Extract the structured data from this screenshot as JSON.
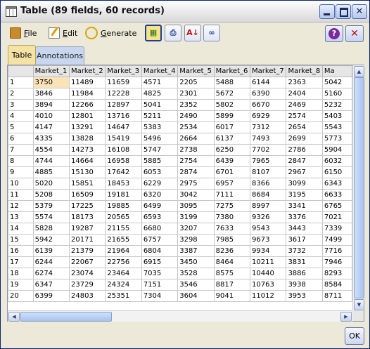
{
  "window": {
    "title": "Table (89 fields, 60 records)"
  },
  "toolbar": {
    "file_label": "File",
    "file_mnemonic": "F",
    "edit_label": "Edit",
    "edit_mnemonic": "E",
    "generate_label": "Generate",
    "generate_mnemonic": "G",
    "help_glyph": "?",
    "close_glyph": "✕"
  },
  "tabs": [
    {
      "label": "Table"
    },
    {
      "label": "Annotations"
    }
  ],
  "table": {
    "columns": [
      "Market_1",
      "Market_2",
      "Market_3",
      "Market_4",
      "Market_5",
      "Market_6",
      "Market_7",
      "Market_8",
      "Ma"
    ],
    "rows": [
      [
        "1",
        "3750",
        "11489",
        "11659",
        "4571",
        "2205",
        "5488",
        "6144",
        "2363",
        "5042"
      ],
      [
        "2",
        "3846",
        "11984",
        "12228",
        "4825",
        "2301",
        "5672",
        "6390",
        "2404",
        "5160"
      ],
      [
        "3",
        "3894",
        "12266",
        "12897",
        "5041",
        "2352",
        "5802",
        "6670",
        "2469",
        "5232"
      ],
      [
        "4",
        "4010",
        "12801",
        "13716",
        "5211",
        "2490",
        "5899",
        "6929",
        "2574",
        "5403"
      ],
      [
        "5",
        "4147",
        "13291",
        "14647",
        "5383",
        "2534",
        "6017",
        "7312",
        "2654",
        "5543"
      ],
      [
        "6",
        "4335",
        "13828",
        "15419",
        "5496",
        "2664",
        "6137",
        "7493",
        "2699",
        "5773"
      ],
      [
        "7",
        "4554",
        "14273",
        "16108",
        "5747",
        "2738",
        "6250",
        "7702",
        "2786",
        "5904"
      ],
      [
        "8",
        "4744",
        "14664",
        "16958",
        "5885",
        "2754",
        "6439",
        "7965",
        "2847",
        "6032"
      ],
      [
        "9",
        "4885",
        "15130",
        "17642",
        "6053",
        "2874",
        "6701",
        "8107",
        "2967",
        "6150"
      ],
      [
        "10",
        "5020",
        "15851",
        "18453",
        "6229",
        "2975",
        "6957",
        "8366",
        "3099",
        "6343"
      ],
      [
        "11",
        "5208",
        "16509",
        "19181",
        "6320",
        "3042",
        "7111",
        "8684",
        "3195",
        "6633"
      ],
      [
        "12",
        "5379",
        "17225",
        "19885",
        "6499",
        "3095",
        "7275",
        "8997",
        "3341",
        "6765"
      ],
      [
        "13",
        "5574",
        "18173",
        "20565",
        "6593",
        "3199",
        "7380",
        "9326",
        "3376",
        "7021"
      ],
      [
        "14",
        "5828",
        "19287",
        "21155",
        "6680",
        "3207",
        "7633",
        "9543",
        "3443",
        "7339"
      ],
      [
        "15",
        "5942",
        "20171",
        "21655",
        "6757",
        "3298",
        "7985",
        "9673",
        "3617",
        "7499"
      ],
      [
        "16",
        "6139",
        "21379",
        "21964",
        "6804",
        "3387",
        "8236",
        "9934",
        "3732",
        "7716"
      ],
      [
        "17",
        "6244",
        "22067",
        "22756",
        "6915",
        "3450",
        "8464",
        "10211",
        "3831",
        "7946"
      ],
      [
        "18",
        "6274",
        "23074",
        "23464",
        "7035",
        "3528",
        "8575",
        "10440",
        "3886",
        "8293"
      ],
      [
        "19",
        "6347",
        "23729",
        "24324",
        "7151",
        "3546",
        "8817",
        "10763",
        "3938",
        "8584"
      ],
      [
        "20",
        "6399",
        "24803",
        "25351",
        "7304",
        "3604",
        "9041",
        "11012",
        "3953",
        "8711"
      ]
    ]
  },
  "footer": {
    "ok_label": "OK"
  },
  "colors": {
    "selected_cell": "#fbe3b8",
    "active_tab": "#f4e3a4",
    "inactive_tab": "#c9d6ef"
  }
}
